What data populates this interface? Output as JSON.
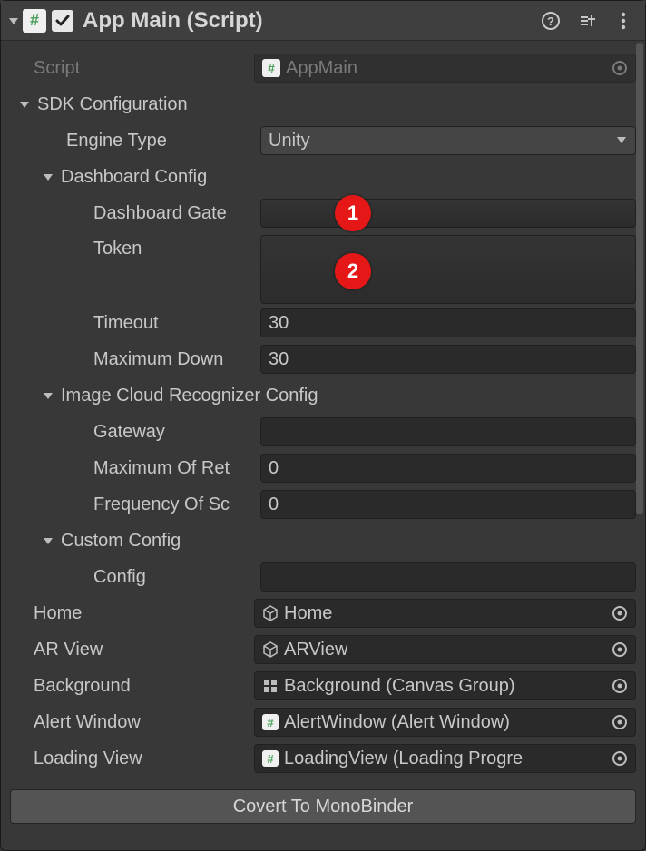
{
  "header": {
    "title": "App Main (Script)",
    "enabled": true
  },
  "script": {
    "label": "Script",
    "value": "AppMain"
  },
  "sdk": {
    "header": "SDK Configuration",
    "engine_type": {
      "label": "Engine Type",
      "value": "Unity"
    },
    "dashboard": {
      "header": "Dashboard Config",
      "gateway": {
        "label": "Dashboard Gate",
        "value": ""
      },
      "token": {
        "label": "Token",
        "value": ""
      },
      "timeout": {
        "label": "Timeout",
        "value": "30"
      },
      "max_down": {
        "label": "Maximum Down",
        "value": "30"
      }
    },
    "cloud": {
      "header": "Image Cloud Recognizer Config",
      "gateway": {
        "label": "Gateway",
        "value": ""
      },
      "max_ret": {
        "label": "Maximum Of Ret",
        "value": "0"
      },
      "freq": {
        "label": "Frequency Of Sc",
        "value": "0"
      }
    },
    "custom": {
      "header": "Custom Config",
      "config": {
        "label": "Config",
        "value": ""
      }
    }
  },
  "refs": {
    "home": {
      "label": "Home",
      "value": "Home",
      "icon": "cube"
    },
    "ar_view": {
      "label": "AR View",
      "value": "ARView",
      "icon": "cube"
    },
    "background": {
      "label": "Background",
      "value": "Background (Canvas Group)",
      "icon": "grid"
    },
    "alert": {
      "label": "Alert Window",
      "value": "AlertWindow (Alert Window)",
      "icon": "script"
    },
    "loading": {
      "label": "Loading View",
      "value": "LoadingView (Loading Progre",
      "icon": "script"
    }
  },
  "button": {
    "label": "Covert To MonoBinder"
  },
  "annotations": {
    "one": "1",
    "two": "2"
  }
}
